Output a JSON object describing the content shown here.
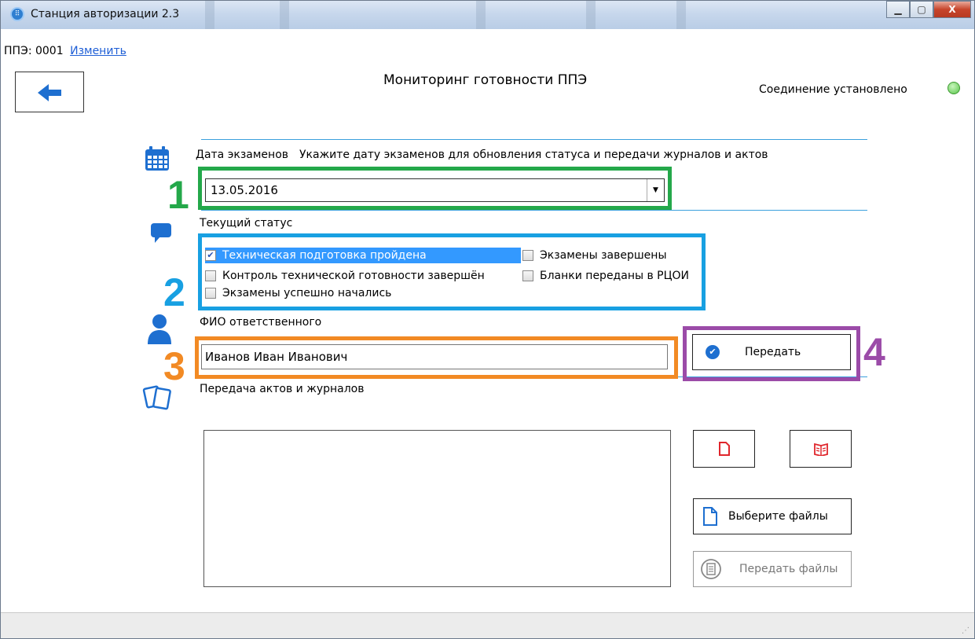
{
  "window": {
    "title": "Станция авторизации 2.3",
    "minimize_glyph": "▁",
    "maximize_glyph": "▢",
    "close_glyph": "X"
  },
  "menubar": {
    "ppe_label": "ППЭ: 0001",
    "change_link": "Изменить"
  },
  "header": {
    "title": "Мониторинг готовности ППЭ",
    "connection_status": "Соединение установлено",
    "connection_color": "#59c64a"
  },
  "exam_date": {
    "label": "Дата экзаменов",
    "hint": "Укажите дату экзаменов для обновления статуса и передачи журналов и актов",
    "value": "13.05.2016"
  },
  "status": {
    "label": "Текущий статус",
    "items": [
      {
        "label": "Техническая подготовка пройдена",
        "checked": true
      },
      {
        "label": "Контроль технической готовности завершён",
        "checked": false
      },
      {
        "label": "Экзамены успешно начались",
        "checked": false
      },
      {
        "label": "Экзамены завершены",
        "checked": false
      },
      {
        "label": "Бланки переданы в РЦОИ",
        "checked": false
      }
    ]
  },
  "responsible": {
    "label": "ФИО ответственного",
    "value": "Иванов Иван Иванович"
  },
  "send_button": {
    "label": "Передать"
  },
  "acts": {
    "label": "Передача актов и журналов",
    "select_files_label": "Выберите файлы",
    "send_files_label": "Передать файлы"
  },
  "annotations": {
    "n1": "1",
    "n2": "2",
    "n3": "3",
    "n4": "4"
  },
  "colors": {
    "accent_line": "#3ba0dd",
    "icon_blue": "#1e6fd0",
    "highlight_green": "#24a84a",
    "highlight_blue": "#18a0e2",
    "highlight_orange": "#f28a24",
    "highlight_purple": "#9b4ba8",
    "file_icon_red": "#e0262c"
  }
}
